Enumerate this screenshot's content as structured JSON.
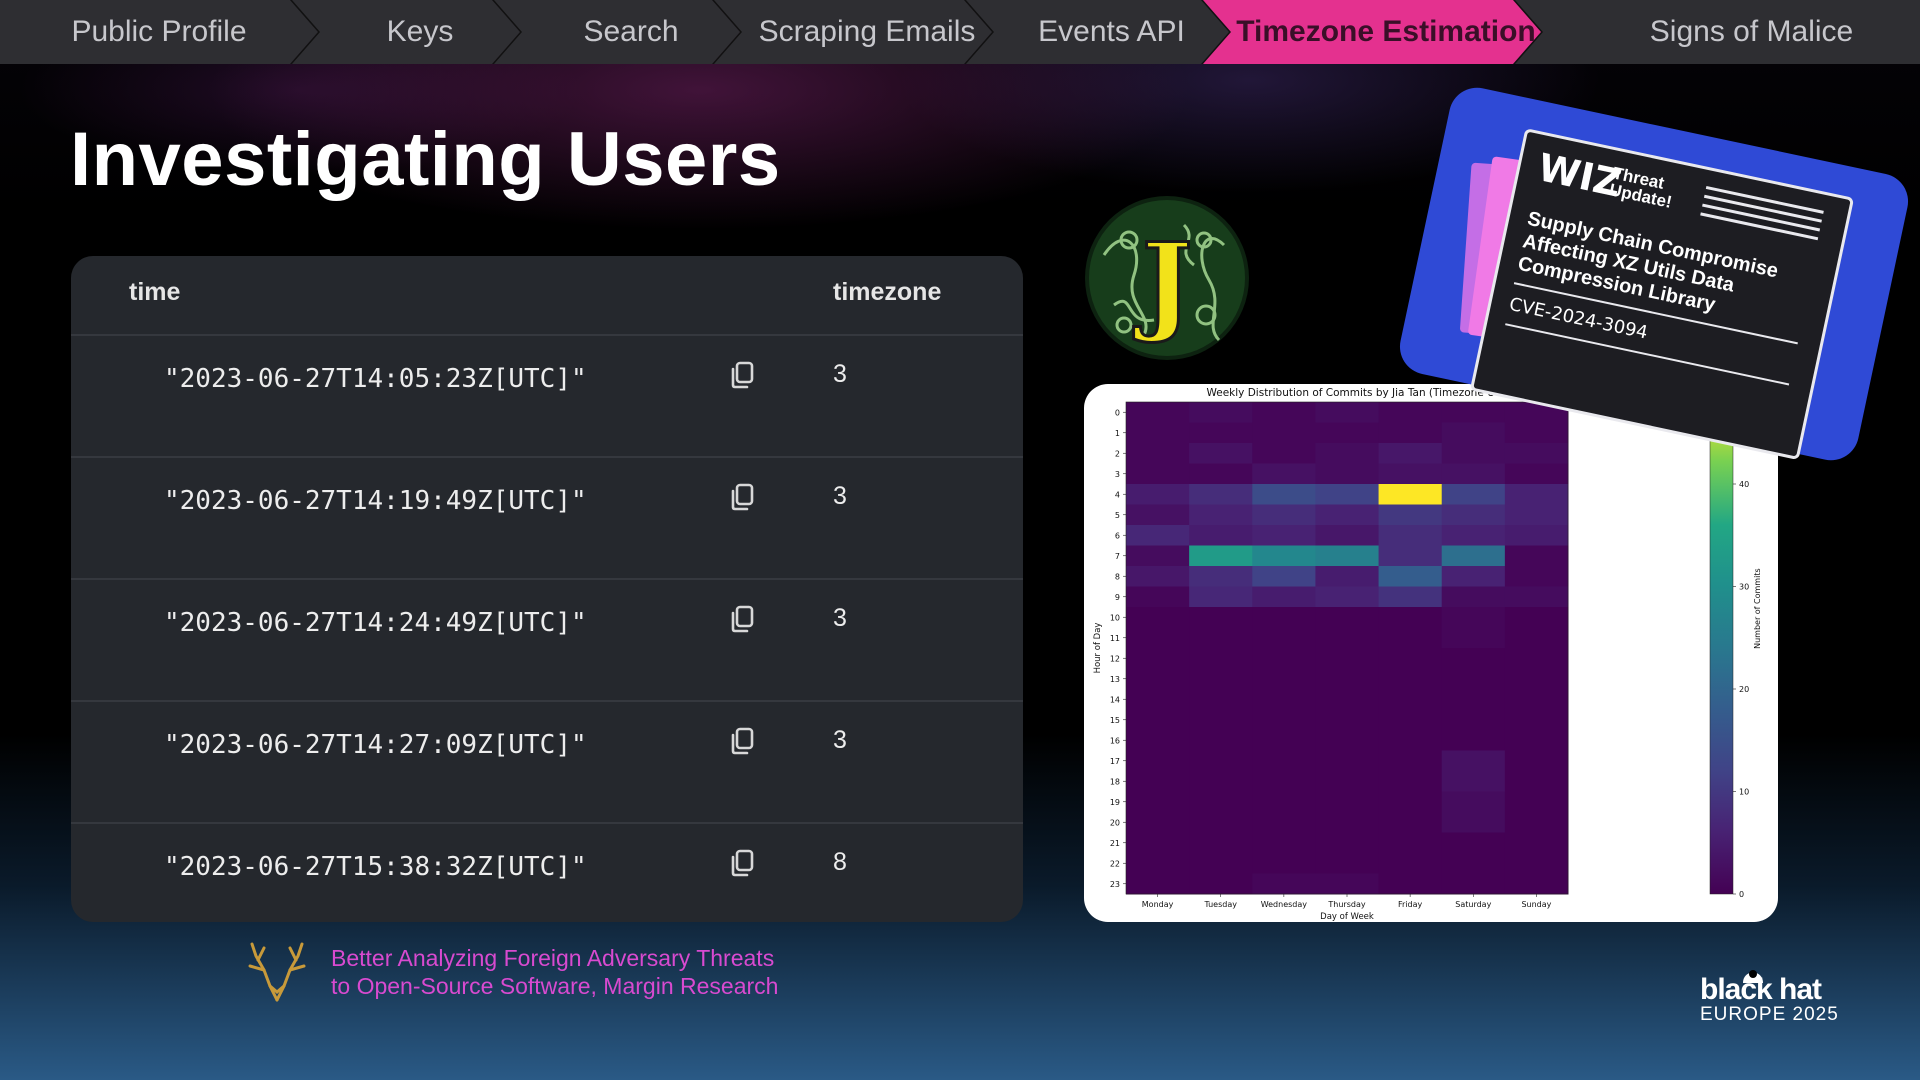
{
  "nav": {
    "items": [
      {
        "label": "Public Profile"
      },
      {
        "label": "Keys"
      },
      {
        "label": "Search"
      },
      {
        "label": "Scraping Emails"
      },
      {
        "label": "Events API"
      },
      {
        "label": "Timezone Estimation",
        "active": true
      },
      {
        "label": "Signs of Malice"
      }
    ],
    "active_color": "#e4318f"
  },
  "title": "Investigating Users",
  "table": {
    "headers": {
      "time": "time",
      "timezone": "timezone"
    },
    "rows": [
      {
        "time": "\"2023-06-27T14:05:23Z[UTC]\"",
        "timezone": "3"
      },
      {
        "time": "\"2023-06-27T14:19:49Z[UTC]\"",
        "timezone": "3"
      },
      {
        "time": "\"2023-06-27T14:24:49Z[UTC]\"",
        "timezone": "3"
      },
      {
        "time": "\"2023-06-27T14:27:09Z[UTC]\"",
        "timezone": "3"
      },
      {
        "time": "\"2023-06-27T15:38:32Z[UTC]\"",
        "timezone": "8"
      }
    ],
    "copy_icon": "copy-icon"
  },
  "jlogo": {
    "letter": "J"
  },
  "wiz": {
    "brand": "WIZ",
    "tag": "Threat Update!",
    "headline": "Supply Chain Compromise Affecting XZ Utils Data Compression Library",
    "cve": "CVE-2024-3094"
  },
  "chart_data": {
    "type": "heatmap",
    "title": "Weekly Distribution of Commits by Jia Tan (Timezone UTC+8)",
    "xlabel": "Day of Week",
    "ylabel": "Hour of Day",
    "colorbar_label": "Number of Commits",
    "colormap": "viridis",
    "vmin": 0,
    "vmax": 48,
    "colorbar_ticks": [
      0,
      10,
      20,
      30,
      40
    ],
    "x": [
      "Monday",
      "Tuesday",
      "Wednesday",
      "Thursday",
      "Friday",
      "Saturday",
      "Sunday"
    ],
    "y": [
      "0",
      "1",
      "2",
      "3",
      "4",
      "5",
      "6",
      "7",
      "8",
      "9",
      "10",
      "11",
      "12",
      "13",
      "14",
      "15",
      "16",
      "17",
      "18",
      "19",
      "20",
      "21",
      "22",
      "23"
    ],
    "values": [
      [
        1,
        2,
        1,
        2,
        1,
        1,
        1
      ],
      [
        1,
        1,
        1,
        1,
        1,
        2,
        1
      ],
      [
        1,
        3,
        1,
        2,
        4,
        2,
        2
      ],
      [
        1,
        1,
        3,
        2,
        3,
        3,
        1
      ],
      [
        5,
        8,
        14,
        12,
        48,
        12,
        6
      ],
      [
        3,
        6,
        8,
        6,
        10,
        8,
        6
      ],
      [
        7,
        5,
        6,
        4,
        8,
        6,
        5
      ],
      [
        2,
        33,
        28,
        26,
        8,
        22,
        1
      ],
      [
        4,
        8,
        12,
        5,
        18,
        6,
        1
      ],
      [
        1,
        7,
        5,
        6,
        9,
        2,
        2
      ],
      [
        0,
        0,
        0,
        0,
        0,
        1,
        0
      ],
      [
        0,
        0,
        0,
        0,
        0,
        1,
        0
      ],
      [
        0,
        0,
        0,
        0,
        0,
        0,
        0
      ],
      [
        0,
        0,
        0,
        0,
        0,
        0,
        0
      ],
      [
        0,
        0,
        0,
        0,
        0,
        0,
        0
      ],
      [
        0,
        0,
        0,
        0,
        0,
        0,
        0
      ],
      [
        0,
        0,
        0,
        0,
        0,
        0,
        0
      ],
      [
        0,
        0,
        0,
        0,
        0,
        3,
        0
      ],
      [
        0,
        0,
        0,
        0,
        0,
        3,
        0
      ],
      [
        0,
        0,
        0,
        0,
        0,
        2,
        0
      ],
      [
        0,
        0,
        0,
        0,
        0,
        2,
        0
      ],
      [
        0,
        0,
        0,
        0,
        0,
        0,
        0
      ],
      [
        0,
        0,
        0,
        0,
        0,
        0,
        0
      ],
      [
        0,
        0,
        1,
        1,
        0,
        0,
        0
      ]
    ]
  },
  "footer": {
    "line1": "Better Analyzing Foreign Adversary Threats",
    "line2": "to Open-Source Software, Margin Research",
    "color": "#d84ad0"
  },
  "logo": {
    "main": "black hat",
    "sub": "EUROPE 2025"
  }
}
